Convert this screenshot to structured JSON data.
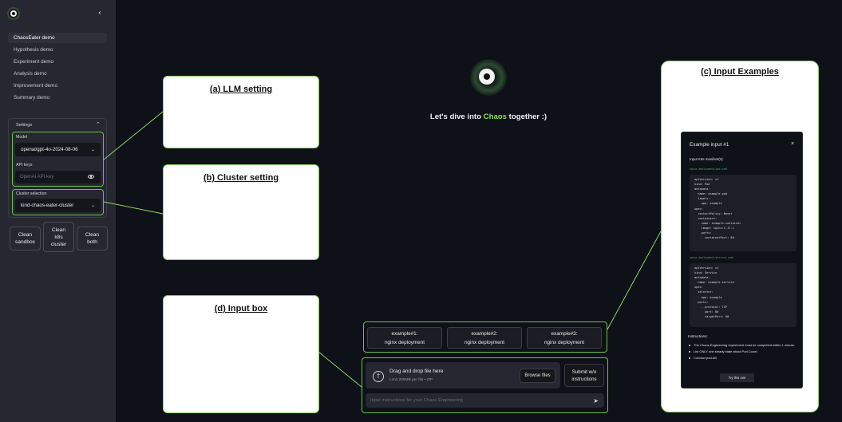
{
  "sidebar": {
    "collapse_icon": "chevron-left-icon",
    "nav": [
      "ChaosEater demo",
      "Hypothesis demo",
      "Experiment demo",
      "Analysis demo",
      "Improvement demo",
      "Summary demo"
    ],
    "settings": {
      "title": "Settings",
      "model_label": "Model",
      "model_value": "openai/gpt-4o-2024-08-06",
      "api_keys_label": "API keys",
      "api_key_placeholder": "OpenAI API key",
      "cluster_label": "Cluster selection",
      "cluster_value": "kind-chaos-eater-cluster"
    },
    "buttons": {
      "clean_sandbox": "Clean\nsandbox",
      "clean_k8s": "Clean\nk8s\ncluster",
      "clean_both": "Clean\nboth"
    }
  },
  "annotations": {
    "a": "(a) LLM setting",
    "b": "(b) Cluster setting",
    "c": "(c) Input Examples",
    "d": "(d) Input box"
  },
  "main": {
    "tagline_before": "Let's dive into ",
    "tagline_highlight": "Chaos",
    "tagline_after": " together :)",
    "examples": [
      {
        "line1": "example#1:",
        "line2": "nginx deployment"
      },
      {
        "line1": "example#2:",
        "line2": "nginx deployment"
      },
      {
        "line1": "example#3:",
        "line2": "nginx deployment"
      }
    ],
    "upload": {
      "title": "Drag and drop file here",
      "subtitle": "Limit 200MB per file • ZIP",
      "browse": "Browse files",
      "submit": "Submit w/o\ninstructions"
    },
    "chat_placeholder": "Input instructions for your Chaos Engineering"
  },
  "dialog": {
    "title": "Example input #1",
    "close": "×",
    "manifests_label": "Input K8s manifest(s):",
    "file1": "nginx_deployment/pod.yaml",
    "code1": "apiVersion: v1\nkind: Pod\nmetadata:\n  name: example-pod\n  labels:\n    app: example\nspec:\n  restartPolicy: Never\n  containers:\n  - name: example-container\n    image: nginx:1.17.1\n    ports:\n    - containerPort: 80",
    "file2": "nginx_deployment/service.yaml",
    "code2": "apiVersion: v1\nkind: Service\nmetadata:\n  name: example-service\nspec:\n  selector:\n    app: example\n  ports:\n    - protocol: TCP\n      port: 80\n      targetPort: 80",
    "instructions_label": "Instructions:",
    "instructions": [
      "The Chaos-Engineering experiment must be completed within 1 minute.",
      "List ONLY one steady state about Pod Count.",
      "Conduct pod-kill"
    ],
    "try_button": "Try this one"
  },
  "colors": {
    "accent_green": "#86e05a",
    "annotation_border": "#8fd16a",
    "background": "#0e1117",
    "sidebar": "#262730"
  }
}
